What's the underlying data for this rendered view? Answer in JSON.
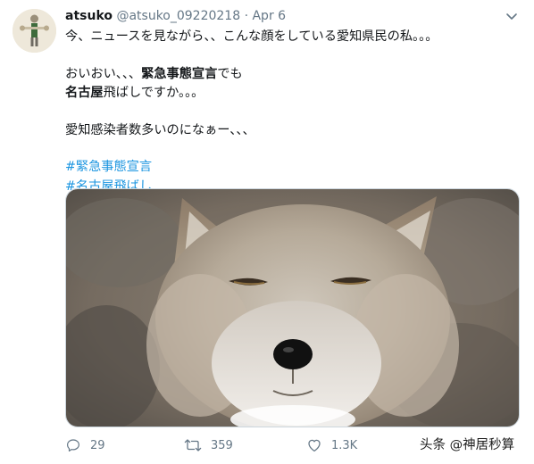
{
  "tweet": {
    "author_name": "atsuko",
    "author_handle": "@atsuko_09220218",
    "separator": "·",
    "date": "Apr 6",
    "line1": "今、ニュースを見ながら、、こんな顔をしている愛知県民の私。。。",
    "line2_start": "おいおい、、、",
    "line2_bold": "緊急事態宣言",
    "line2_end": "でも",
    "line3_bold": "名古屋",
    "line3_end": "飛ばしですか。。。",
    "line4": "愛知感染者数多いのになぁー、、、",
    "hashtags": [
      "#緊急事態宣言",
      "#名古屋飛ばし"
    ],
    "media_alt": "fox-photo"
  },
  "actions": {
    "reply_count": "29",
    "retweet_count": "359",
    "like_count": "1.3K"
  },
  "watermark": "头条 @神居秒算",
  "icons": {
    "reply": "reply-icon",
    "retweet": "retweet-icon",
    "like": "heart-icon",
    "share": "share-icon",
    "more": "chevron-down-icon"
  },
  "colors": {
    "hashtag": "#1b95e0",
    "muted": "#657786"
  }
}
